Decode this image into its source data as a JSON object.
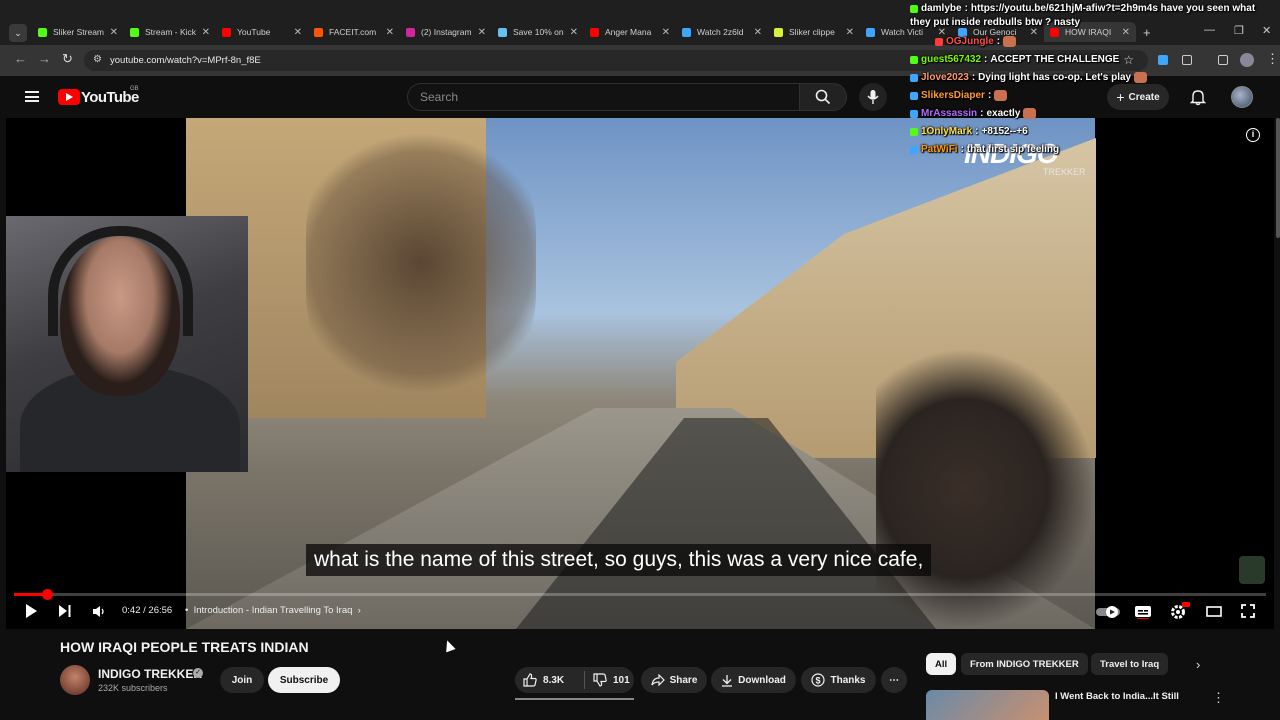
{
  "browser": {
    "tabs": [
      {
        "title": "Sliker Stream",
        "color": "#53fc18"
      },
      {
        "title": "Stream - Kick",
        "color": "#53fc18"
      },
      {
        "title": "YouTube",
        "color": "#ff0000"
      },
      {
        "title": "FACEIT.com",
        "color": "#ff5500"
      },
      {
        "title": "(2) Instagram",
        "color": "#d6249f"
      },
      {
        "title": "Save 10% on",
        "color": "#66c0f4"
      },
      {
        "title": "Anger Mana",
        "color": "#ff0000"
      },
      {
        "title": "Watch 2z6ld",
        "color": "#3ea6ff"
      },
      {
        "title": "Sliker clippe",
        "color": "#d9f03a"
      },
      {
        "title": "Watch Victi",
        "color": "#3ea6ff"
      },
      {
        "title": "Our Genoci",
        "color": "#3ea6ff"
      },
      {
        "title": "HOW IRAQI",
        "color": "#ff0000",
        "active": true
      }
    ],
    "url": "youtube.com/watch?v=MPrf-8n_f8E"
  },
  "youtube": {
    "logo_text": "YouTube",
    "country": "GB",
    "search_placeholder": "Search",
    "create_label": "Create"
  },
  "video": {
    "watermark": "INDIGO",
    "watermark_sub": "TREKKER",
    "caption": "what is the name of this street, so guys, this was a very nice cafe,",
    "time": "0:42 / 26:56",
    "chapter": "Introduction - Indian Travelling To Iraq",
    "progress": 0.026
  },
  "chat": [
    {
      "user": "damlybe",
      "text": "https://youtu.be/621hjM-afiw?t=2h9m4s have you seen what",
      "color": "#ffffff"
    },
    {
      "user": "",
      "text": "they put inside redbulls btw ? nasty",
      "color": "#ffffff"
    },
    {
      "user": "OGJungle",
      "text": "",
      "color": "#ff4d4d"
    },
    {
      "user": "guest567432",
      "text": "ACCEPT THE CHALLENGE",
      "color": "#7CFC00"
    },
    {
      "user": "Jlove2023",
      "text": "Dying light has co-op. Let's play",
      "color": "#ff9966"
    },
    {
      "user": "SlikersDiaper",
      "text": "",
      "color": "#ff9b30"
    },
    {
      "user": "MrAssassin",
      "text": "exactly",
      "color": "#b06cff"
    },
    {
      "user": "1OnlyMark",
      "text": "+8152--+6",
      "color": "#ffe14d"
    },
    {
      "user": "PatWiFi",
      "text": "that first sip feeling",
      "color": "#ff9900"
    }
  ],
  "info": {
    "title": "HOW IRAQI PEOPLE TREATS INDIAN",
    "channel": "INDIGO TREKKER",
    "subscribers": "232K subscribers",
    "join": "Join",
    "subscribe": "Subscribe",
    "likes": "8.3K",
    "dislikes": "101",
    "share": "Share",
    "download": "Download",
    "thanks": "Thanks"
  },
  "chips": [
    "All",
    "From INDIGO TREKKER",
    "Travel to Iraq"
  ],
  "recommended": {
    "title": "I Went Back to India...It Still"
  }
}
